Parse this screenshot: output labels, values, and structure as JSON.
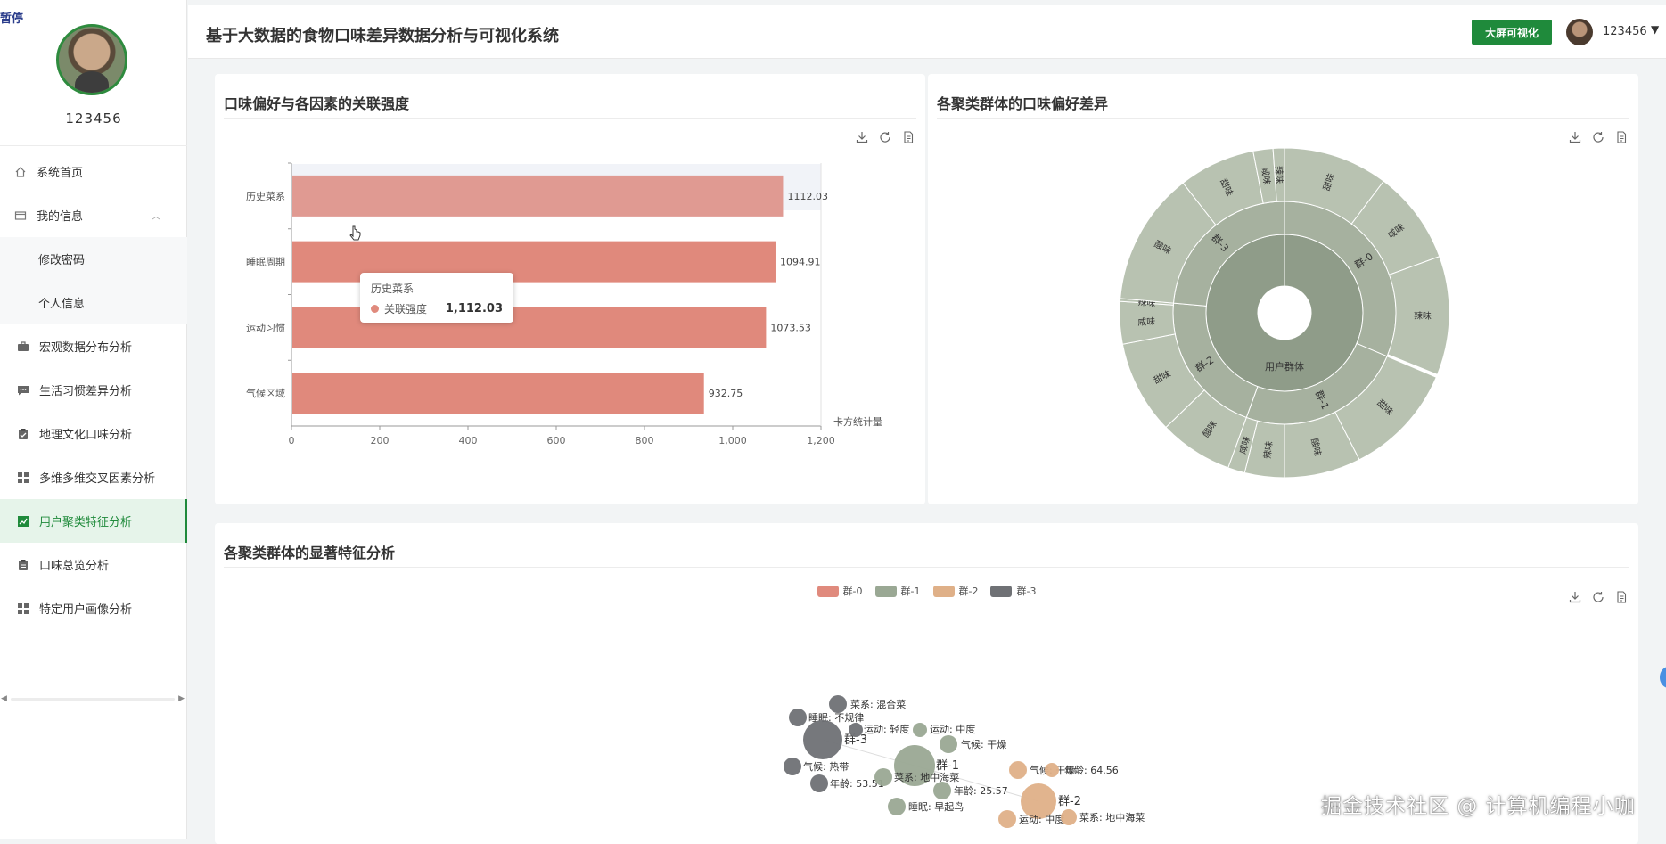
{
  "sidebar": {
    "corner_label": "暂停",
    "username": "123456",
    "menu": [
      {
        "label": "系统首页",
        "icon": "home-icon"
      },
      {
        "label": "我的信息",
        "icon": "card-icon"
      },
      {
        "label": "修改密码"
      },
      {
        "label": "个人信息"
      },
      {
        "label": "宏观数据分布分析",
        "icon": "briefcase-icon"
      },
      {
        "label": "生活习惯差异分析",
        "icon": "message-icon"
      },
      {
        "label": "地理文化口味分析",
        "icon": "clipboard-check-icon"
      },
      {
        "label": "多维多维交叉因素分析",
        "icon": "grid-icon"
      },
      {
        "label": "用户聚类特征分析",
        "icon": "chart-icon"
      },
      {
        "label": "口味总览分析",
        "icon": "clipboard-icon"
      },
      {
        "label": "特定用户画像分析",
        "icon": "grid-icon"
      }
    ]
  },
  "header": {
    "title": "基于大数据的食物口味差异数据分析与可视化系统",
    "big_screen_label": "大屏可视化",
    "user": "123456"
  },
  "cards": {
    "bar_title": "口味偏好与各因素的关联强度",
    "sunburst_title": "各聚类群体的口味偏好差异",
    "scatter_title": "各聚类群体的显著特征分析"
  },
  "tooltip": {
    "title": "历史菜系",
    "label": "关联强度",
    "value": "1,112.03"
  },
  "watermark": "掘金技术社区 @ 计算机编程小咖",
  "colors": {
    "accent": "#1f8a3b",
    "bar": "#e08a7d",
    "group0": "#e08a7d",
    "group1": "#9aa894",
    "group2": "#dfb088",
    "group3": "#6f7175"
  },
  "chart_data": [
    {
      "type": "bar",
      "orientation": "horizontal",
      "categories": [
        "历史菜系",
        "睡眠周期",
        "运动习惯",
        "气候区域"
      ],
      "values": [
        1112.03,
        1094.91,
        1073.53,
        932.75
      ],
      "value_labels": [
        "1112.03",
        "1094.91",
        "1073.53",
        "932.75"
      ],
      "xlabel": "卡方统计量",
      "xlim": [
        0,
        1200
      ],
      "x_ticks": [
        "0",
        "200",
        "400",
        "600",
        "800",
        "1,000",
        "1,200"
      ]
    },
    {
      "type": "sunburst",
      "center_label": "用户群体",
      "groups": [
        {
          "name": "群-0",
          "tastes": [
            "甜味",
            "咸味",
            "辣味"
          ]
        },
        {
          "name": "群-1",
          "tastes": [
            "甜味",
            "酸味",
            "辣味",
            "咸味"
          ]
        },
        {
          "name": "群-2",
          "tastes": [
            "酸味",
            "甜味",
            "咸味",
            "辣味"
          ]
        },
        {
          "name": "群-3",
          "tastes": [
            "酸味",
            "甜味",
            "咸味",
            "辣味"
          ]
        }
      ]
    },
    {
      "type": "scatter",
      "legend": [
        "群-0",
        "群-1",
        "群-2",
        "群-3"
      ],
      "labels": [
        "菜系: 混合菜",
        "睡眠: 不规律",
        "群-3",
        "运动: 轻度",
        "运动: 中度",
        "气候: 干燥",
        "气候: 热带",
        "年龄: 53.51",
        "群-1",
        "菜系: 地中海菜",
        "年龄: 25.57",
        "睡眠: 早起鸟",
        "气候: 干燥",
        "年龄: 64.56",
        "群-2",
        "运动: 中度",
        "菜系: 地中海菜"
      ]
    }
  ]
}
